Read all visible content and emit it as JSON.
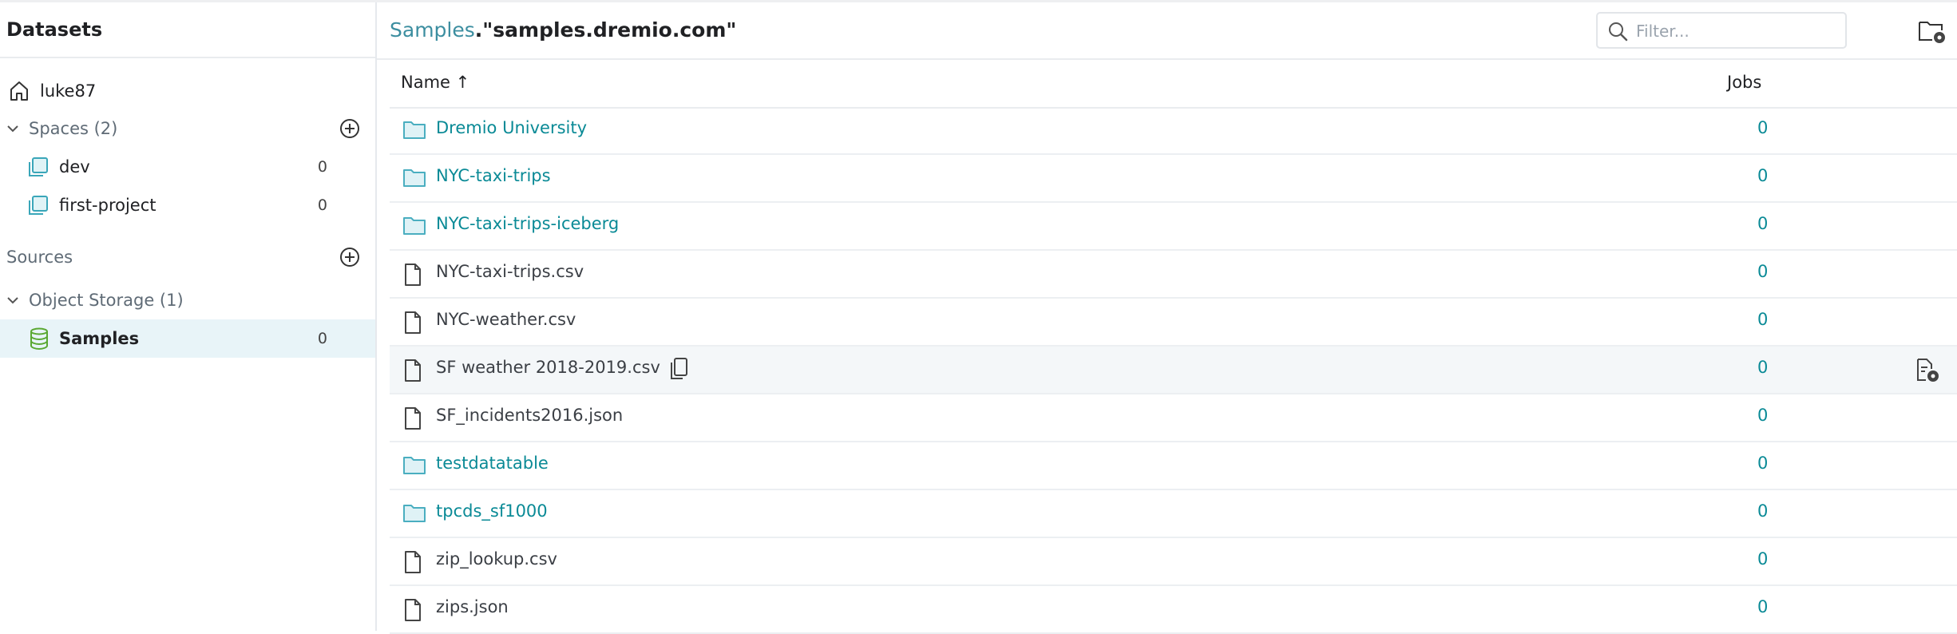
{
  "sidebar": {
    "title": "Datasets",
    "home": {
      "label": "luke87"
    },
    "spaces": {
      "label": "Spaces (2)",
      "items": [
        {
          "label": "dev",
          "count": "0"
        },
        {
          "label": "first-project",
          "count": "0"
        }
      ]
    },
    "sources": {
      "label": "Sources"
    },
    "object_storage": {
      "label": "Object Storage (1)",
      "items": [
        {
          "label": "Samples",
          "count": "0"
        }
      ]
    }
  },
  "header": {
    "breadcrumb_link": "Samples",
    "breadcrumb_current": ".\"samples.dremio.com\"",
    "filter_placeholder": "Filter..."
  },
  "table": {
    "columns": {
      "name": "Name ↑",
      "jobs": "Jobs"
    },
    "rows": [
      {
        "name": "Dremio University",
        "type": "folder",
        "jobs": "0"
      },
      {
        "name": "NYC-taxi-trips",
        "type": "folder",
        "jobs": "0"
      },
      {
        "name": "NYC-taxi-trips-iceberg",
        "type": "folder",
        "jobs": "0"
      },
      {
        "name": "NYC-taxi-trips.csv",
        "type": "file",
        "jobs": "0"
      },
      {
        "name": "NYC-weather.csv",
        "type": "file",
        "jobs": "0"
      },
      {
        "name": "SF weather 2018-2019.csv",
        "type": "file",
        "jobs": "0"
      },
      {
        "name": "SF_incidents2016.json",
        "type": "file",
        "jobs": "0"
      },
      {
        "name": "testdatatable",
        "type": "folder",
        "jobs": "0"
      },
      {
        "name": "tpcds_sf1000",
        "type": "folder",
        "jobs": "0"
      },
      {
        "name": "zip_lookup.csv",
        "type": "file",
        "jobs": "0"
      },
      {
        "name": "zips.json",
        "type": "file",
        "jobs": "0"
      }
    ]
  },
  "colors": {
    "accent": "#0a8a96",
    "breadcrumb": "#3c8ea0",
    "active_bg": "#e8f4f8"
  },
  "icons": [
    "home-icon",
    "chevron-down-icon",
    "add-circle-icon",
    "space-icon",
    "database-icon",
    "folder-icon",
    "file-icon",
    "copy-icon",
    "search-icon",
    "folder-settings-icon",
    "file-settings-icon"
  ]
}
